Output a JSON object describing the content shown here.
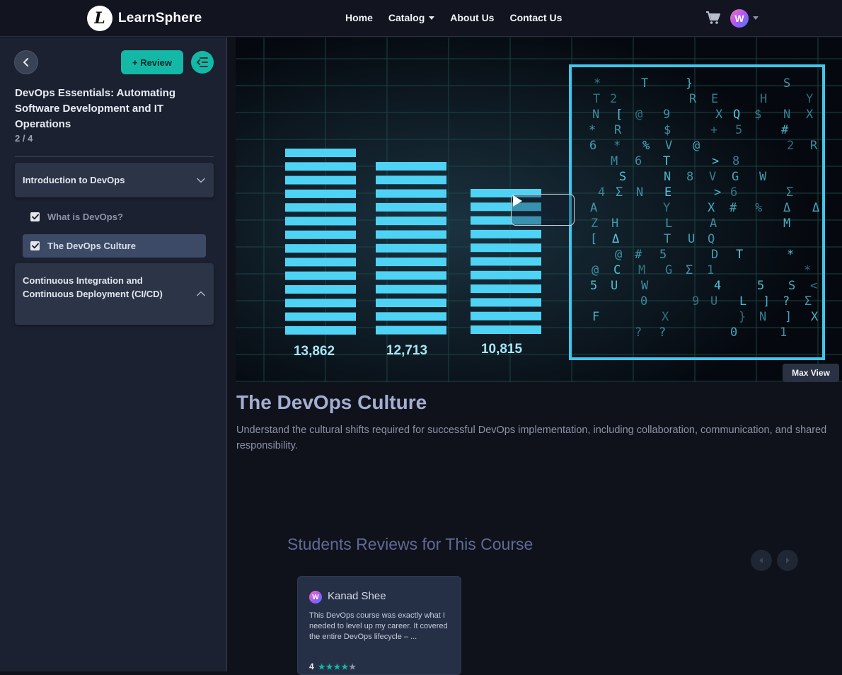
{
  "navbar": {
    "brand": "LearnSphere",
    "logo_letter": "L",
    "links": [
      "Home",
      "Catalog",
      "About Us",
      "Contact Us"
    ],
    "avatar_letter": "W"
  },
  "sidebar": {
    "review_button": "+ Review",
    "course_title": "DevOps Essentials: Automating Software Development and IT Operations",
    "progress": "2 / 4",
    "sections": [
      {
        "title": "Introduction to DevOps",
        "lessons": [
          {
            "title": "What is DevOps?",
            "completed": true
          },
          {
            "title": "The DevOps Culture",
            "completed": true,
            "active": true
          }
        ]
      },
      {
        "title": "Continuous Integration and Continuous Deployment (CI/CD)"
      }
    ]
  },
  "video": {
    "bar_labels": [
      "13,862",
      "12,713",
      "10,815"
    ],
    "max_view_label": "Max View"
  },
  "lesson": {
    "title": "The DevOps Culture",
    "description": "Understand the cultural shifts required for successful DevOps implementation, including collaboration, communication, and shared responsibility."
  },
  "reviews": {
    "heading": "Students Reviews for This Course",
    "items": [
      {
        "avatar_letter": "W",
        "name": "Kanad Shee",
        "text": "This DevOps course was exactly what I needed to level up my career. It covered the entire DevOps lifecycle – ...",
        "rating": "4",
        "stars": 4
      }
    ]
  },
  "colors": {
    "accent": "#14b8a6",
    "sidebar_bg": "#1b2130",
    "page_bg": "#0f121b"
  }
}
